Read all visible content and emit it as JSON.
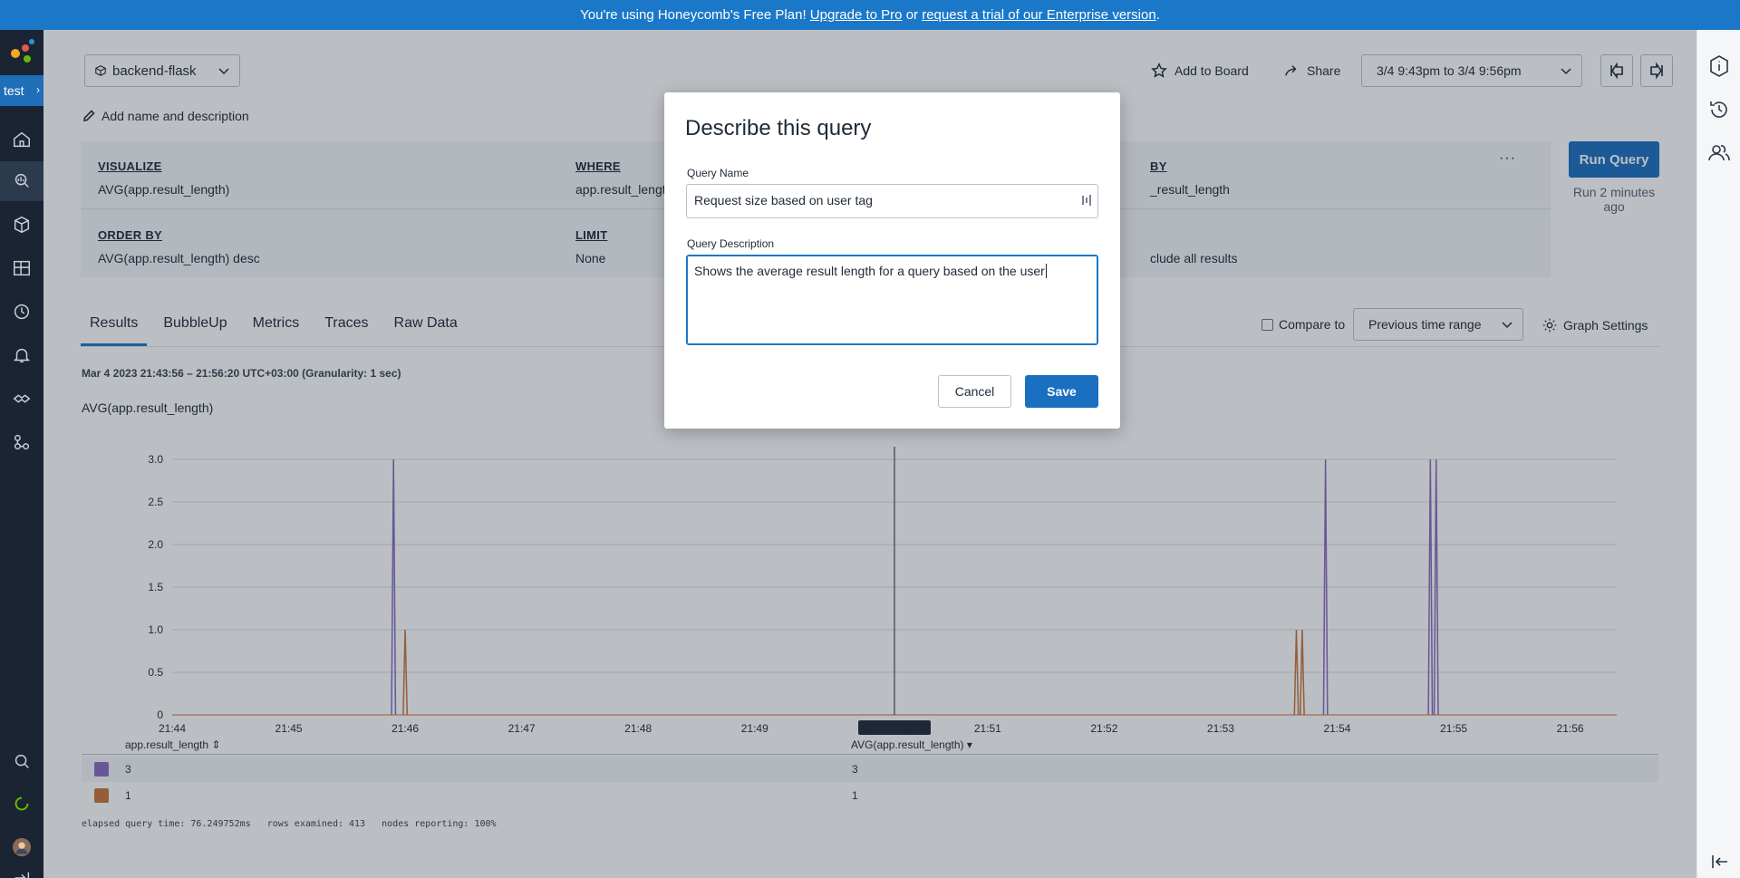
{
  "banner": {
    "text_prefix": "You're using Honeycomb's Free Plan! ",
    "upgrade_link": "Upgrade to Pro",
    "text_middle": " or ",
    "trial_link": "request a trial of our Enterprise version",
    "text_suffix": "."
  },
  "leftnav": {
    "environment": "test",
    "icons": [
      "home-icon",
      "query-icon",
      "datasets-icon",
      "boards-icon",
      "history-icon",
      "triggers-icon",
      "service-map-icon",
      "settings-icon",
      "search-icon",
      "status-icon",
      "avatar"
    ]
  },
  "header": {
    "dataset": "backend-flask",
    "add_name": "Add name and description",
    "add_to_board": "Add to Board",
    "share": "Share",
    "time_range": "3/4 9:43pm to 3/4 9:56pm"
  },
  "query": {
    "visualize_label": "VISUALIZE",
    "visualize_value": "AVG(app.result_length)",
    "where_label": "WHERE",
    "where_value": "app.result_length",
    "groupby_label": "BY",
    "groupby_value": "_result_length",
    "orderby_label": "ORDER BY",
    "orderby_value": "AVG(app.result_length) desc",
    "limit_label": "LIMIT",
    "limit_value": "None",
    "having_value": "clude all results",
    "more": "···"
  },
  "run": {
    "button": "Run Query",
    "info": "Run 2 minutes ago"
  },
  "tabs": [
    "Results",
    "BubbleUp",
    "Metrics",
    "Traces",
    "Raw Data"
  ],
  "controls": {
    "compare_to": "Compare to",
    "previous_range": "Previous time range",
    "graph_settings": "Graph Settings"
  },
  "time_info": "Mar 4 2023 21:43:56 – 21:56:20 UTC+03:00 (Granularity: 1 sec)",
  "chart_data": {
    "type": "line",
    "title": "AVG(app.result_length)",
    "ylim": [
      0,
      3.0
    ],
    "yticks": [
      "3.0",
      "2.5",
      "2.0",
      "1.5",
      "1.0",
      "0.5",
      "0"
    ],
    "xticks": [
      "21:44",
      "21:45",
      "21:46",
      "21:47",
      "21:48",
      "21:49",
      "21:50",
      "21:51",
      "21:52",
      "21:53",
      "21:54",
      "21:55",
      "21:56"
    ],
    "cursor_label": "03/04 21:50:12",
    "grid": true,
    "series": [
      {
        "name": "3",
        "color": "#8a6bbf",
        "spikes_at_minutes": [
          45.9,
          53.9,
          54.8,
          54.85
        ],
        "value": 3
      },
      {
        "name": "1",
        "color": "#c9743a",
        "spikes_at_minutes": [
          46.0,
          53.65,
          53.7
        ],
        "value": 1
      }
    ]
  },
  "results": {
    "col1": "app.result_length",
    "col2": "AVG(app.result_length)",
    "rows": [
      {
        "color": "#8a6bbf",
        "group": "3",
        "value": "3"
      },
      {
        "color": "#c9743a",
        "group": "1",
        "value": "1"
      }
    ]
  },
  "footer": "elapsed query time: 76.249752ms   rows examined: 413   nodes reporting: 100%",
  "modal": {
    "title": "Describe this query",
    "name_label": "Query Name",
    "name_value": "Request size based on user tag",
    "desc_label": "Query Description",
    "desc_value": "Shows the average result length for a query based on the user",
    "cancel": "Cancel",
    "save": "Save"
  }
}
